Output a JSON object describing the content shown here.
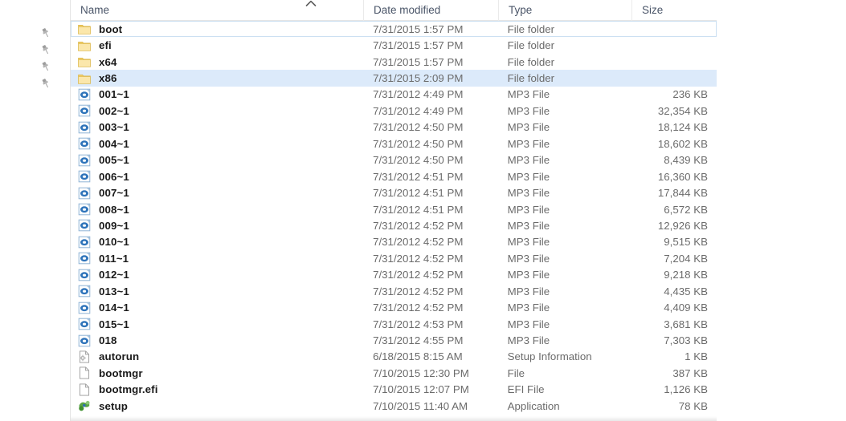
{
  "navpane": {
    "pins": [
      {
        "icon": "pin-icon",
        "name": "pin-icon-1"
      },
      {
        "icon": "pin-icon",
        "name": "pin-icon-2"
      },
      {
        "icon": "pin-icon",
        "name": "pin-icon-3"
      },
      {
        "icon": "pin-icon",
        "name": "pin-icon-4"
      }
    ]
  },
  "columns": {
    "name": "Name",
    "date_modified": "Date modified",
    "type": "Type",
    "size": "Size",
    "sort_indicator": "chevron-up-icon",
    "sorted_by": "Name",
    "sort_direction": "ascending"
  },
  "colors": {
    "selection": "#dceafa",
    "focus_border": "#cce0f2",
    "folder_icon": "#f7d87b",
    "mp3_icon": "#2a6ebb",
    "setup_icon": "#5aa544",
    "header_text": "#4a5568",
    "row_text": "#1a1a1a",
    "meta_text": "#6b6b6b"
  },
  "files": [
    {
      "name": "boot",
      "date": "7/31/2015 1:57 PM",
      "type": "File folder",
      "size": "",
      "icon": "folder-icon",
      "state": "focused"
    },
    {
      "name": "efi",
      "date": "7/31/2015 1:57 PM",
      "type": "File folder",
      "size": "",
      "icon": "folder-icon",
      "state": "normal"
    },
    {
      "name": "x64",
      "date": "7/31/2015 1:57 PM",
      "type": "File folder",
      "size": "",
      "icon": "folder-icon",
      "state": "normal"
    },
    {
      "name": "x86",
      "date": "7/31/2015 2:09 PM",
      "type": "File folder",
      "size": "",
      "icon": "folder-icon",
      "state": "selected"
    },
    {
      "name": "001~1",
      "date": "7/31/2012 4:49 PM",
      "type": "MP3 File",
      "size": "236 KB",
      "icon": "mp3-icon",
      "state": "normal"
    },
    {
      "name": "002~1",
      "date": "7/31/2012 4:49 PM",
      "type": "MP3 File",
      "size": "32,354 KB",
      "icon": "mp3-icon",
      "state": "normal"
    },
    {
      "name": "003~1",
      "date": "7/31/2012 4:50 PM",
      "type": "MP3 File",
      "size": "18,124 KB",
      "icon": "mp3-icon",
      "state": "normal"
    },
    {
      "name": "004~1",
      "date": "7/31/2012 4:50 PM",
      "type": "MP3 File",
      "size": "18,602 KB",
      "icon": "mp3-icon",
      "state": "normal"
    },
    {
      "name": "005~1",
      "date": "7/31/2012 4:50 PM",
      "type": "MP3 File",
      "size": "8,439 KB",
      "icon": "mp3-icon",
      "state": "normal"
    },
    {
      "name": "006~1",
      "date": "7/31/2012 4:51 PM",
      "type": "MP3 File",
      "size": "16,360 KB",
      "icon": "mp3-icon",
      "state": "normal"
    },
    {
      "name": "007~1",
      "date": "7/31/2012 4:51 PM",
      "type": "MP3 File",
      "size": "17,844 KB",
      "icon": "mp3-icon",
      "state": "normal"
    },
    {
      "name": "008~1",
      "date": "7/31/2012 4:51 PM",
      "type": "MP3 File",
      "size": "6,572 KB",
      "icon": "mp3-icon",
      "state": "normal"
    },
    {
      "name": "009~1",
      "date": "7/31/2012 4:52 PM",
      "type": "MP3 File",
      "size": "12,926 KB",
      "icon": "mp3-icon",
      "state": "normal"
    },
    {
      "name": "010~1",
      "date": "7/31/2012 4:52 PM",
      "type": "MP3 File",
      "size": "9,515 KB",
      "icon": "mp3-icon",
      "state": "normal"
    },
    {
      "name": "011~1",
      "date": "7/31/2012 4:52 PM",
      "type": "MP3 File",
      "size": "7,204 KB",
      "icon": "mp3-icon",
      "state": "normal"
    },
    {
      "name": "012~1",
      "date": "7/31/2012 4:52 PM",
      "type": "MP3 File",
      "size": "9,218 KB",
      "icon": "mp3-icon",
      "state": "normal"
    },
    {
      "name": "013~1",
      "date": "7/31/2012 4:52 PM",
      "type": "MP3 File",
      "size": "4,435 KB",
      "icon": "mp3-icon",
      "state": "normal"
    },
    {
      "name": "014~1",
      "date": "7/31/2012 4:52 PM",
      "type": "MP3 File",
      "size": "4,409 KB",
      "icon": "mp3-icon",
      "state": "normal"
    },
    {
      "name": "015~1",
      "date": "7/31/2012 4:53 PM",
      "type": "MP3 File",
      "size": "3,681 KB",
      "icon": "mp3-icon",
      "state": "normal"
    },
    {
      "name": "018",
      "date": "7/31/2012 4:55 PM",
      "type": "MP3 File",
      "size": "7,303 KB",
      "icon": "mp3-icon",
      "state": "normal"
    },
    {
      "name": "autorun",
      "date": "6/18/2015 8:15 AM",
      "type": "Setup Information",
      "size": "1 KB",
      "icon": "setup-information-icon",
      "state": "normal"
    },
    {
      "name": "bootmgr",
      "date": "7/10/2015 12:30 PM",
      "type": "File",
      "size": "387 KB",
      "icon": "generic-file-icon",
      "state": "normal"
    },
    {
      "name": "bootmgr.efi",
      "date": "7/10/2015 12:07 PM",
      "type": "EFI File",
      "size": "1,126 KB",
      "icon": "generic-file-icon",
      "state": "normal"
    },
    {
      "name": "setup",
      "date": "7/10/2015 11:40 AM",
      "type": "Application",
      "size": "78 KB",
      "icon": "application-icon",
      "state": "normal"
    }
  ]
}
